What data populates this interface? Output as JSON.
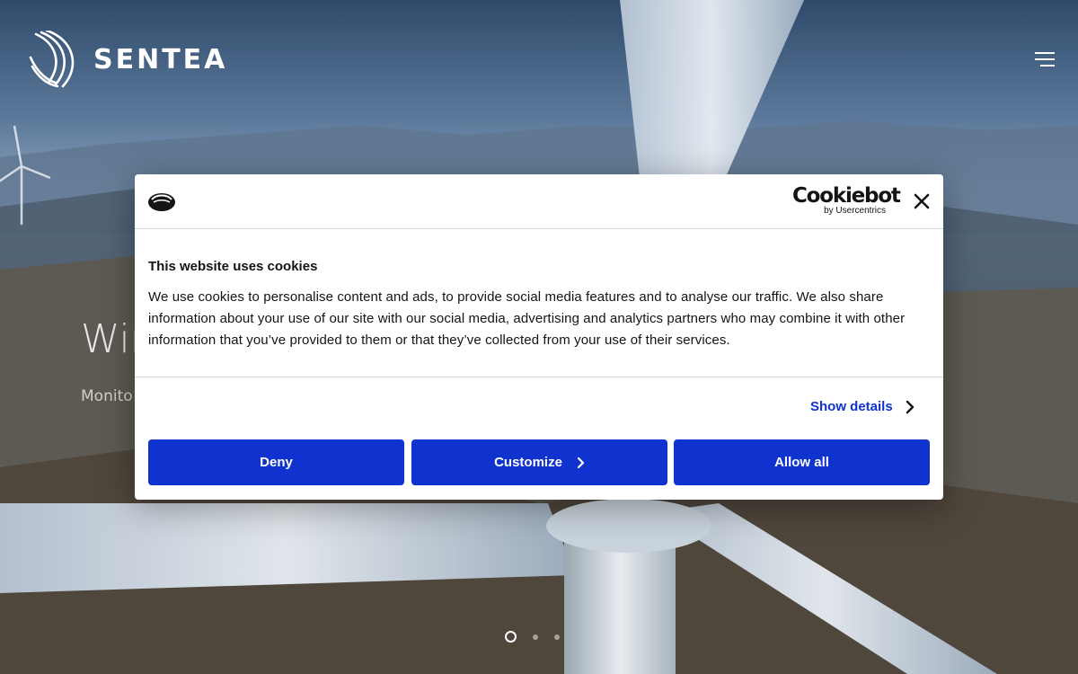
{
  "header": {
    "brand_name": "SENTEA",
    "icons": {
      "logo": "sentea-logo-icon",
      "menu": "hamburger-menu-icon"
    }
  },
  "hero": {
    "title": "Wind",
    "subtitle": "Monito",
    "slider": {
      "slides": 3,
      "active_slide": 1
    }
  },
  "cookie_dialog": {
    "brand": {
      "name": "Cookiebot",
      "tagline": "by Usercentrics"
    },
    "title": "This website uses cookies",
    "body": "We use cookies to personalise content and ads, to provide social media features and to analyse our traffic. We also share information about your use of our site with our social media, advertising and analytics partners who may combine it with other information that you’ve provided to them or that they’ve collected from your use of their services.",
    "show_details_label": "Show details",
    "buttons": {
      "deny": "Deny",
      "customize": "Customize",
      "allow_all": "Allow all"
    },
    "icons": {
      "cookie": "cookie-icon",
      "close": "close-icon",
      "chevron": "chevron-right-icon"
    },
    "colors": {
      "primary": "#1032cf",
      "text": "#141414"
    }
  }
}
